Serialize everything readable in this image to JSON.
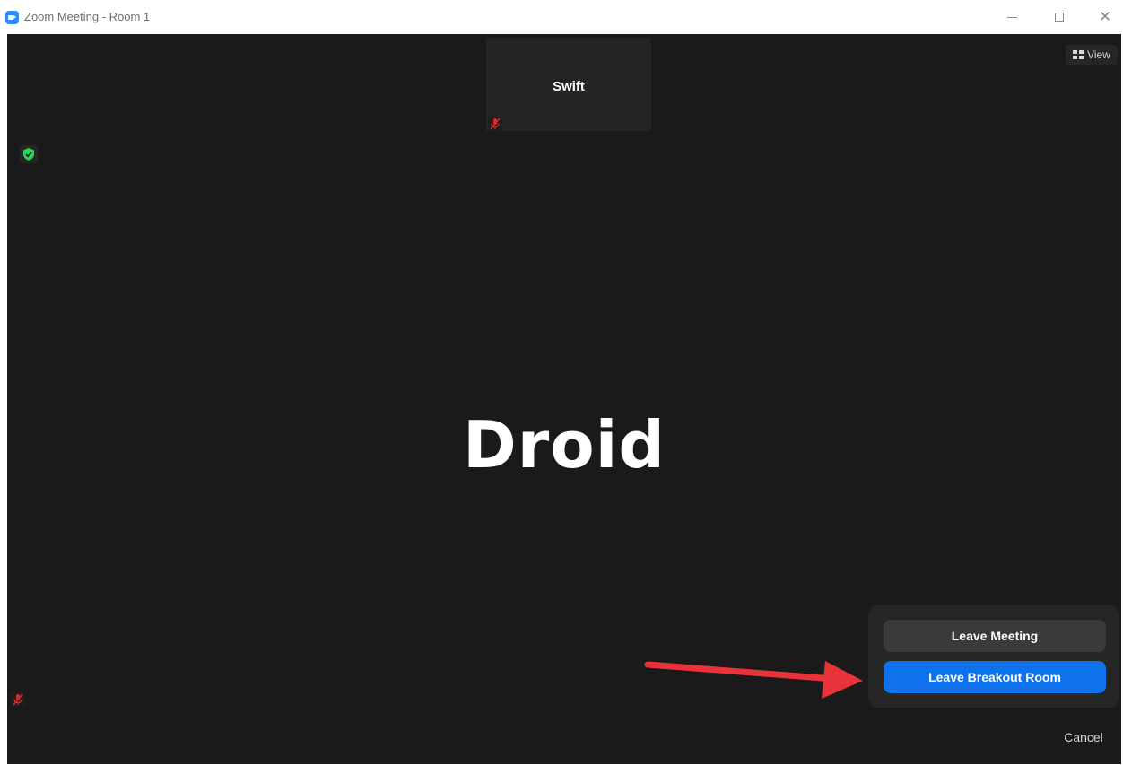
{
  "window": {
    "title": "Zoom Meeting - Room 1"
  },
  "meeting": {
    "view_label": "View",
    "thumbnail_name": "Swift",
    "active_speaker": "Droid"
  },
  "leave_menu": {
    "leave_meeting_label": "Leave Meeting",
    "leave_breakout_label": "Leave Breakout Room",
    "cancel_label": "Cancel"
  },
  "colors": {
    "stage_bg": "#1a1a1a",
    "panel_bg": "#262626",
    "primary_blue": "#0e72ed",
    "secondary_btn": "#3a3a3a",
    "muted_red": "#e02828",
    "shield_green": "#23d959",
    "annotation_arrow": "#e8333a"
  },
  "icons": {
    "app": "zoom-icon",
    "security": "shield-check-icon",
    "muted_mic": "mic-muted-icon",
    "view": "grid-view-icon"
  }
}
